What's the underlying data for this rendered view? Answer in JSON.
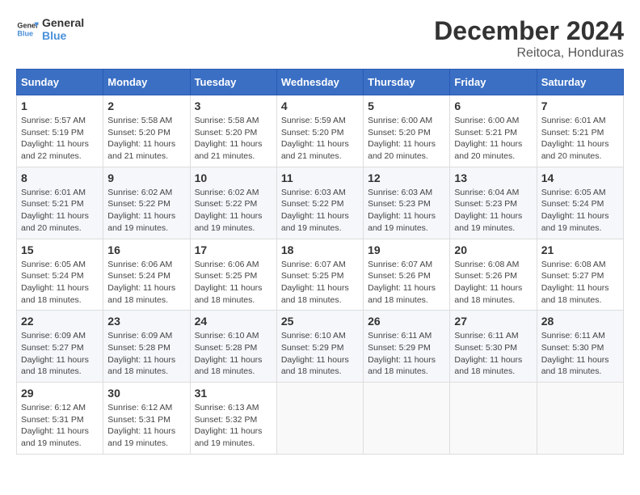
{
  "logo": {
    "line1": "General",
    "line2": "Blue"
  },
  "title": "December 2024",
  "location": "Reitoca, Honduras",
  "days_of_week": [
    "Sunday",
    "Monday",
    "Tuesday",
    "Wednesday",
    "Thursday",
    "Friday",
    "Saturday"
  ],
  "weeks": [
    [
      {
        "day": "1",
        "info": "Sunrise: 5:57 AM\nSunset: 5:19 PM\nDaylight: 11 hours\nand 22 minutes."
      },
      {
        "day": "2",
        "info": "Sunrise: 5:58 AM\nSunset: 5:20 PM\nDaylight: 11 hours\nand 21 minutes."
      },
      {
        "day": "3",
        "info": "Sunrise: 5:58 AM\nSunset: 5:20 PM\nDaylight: 11 hours\nand 21 minutes."
      },
      {
        "day": "4",
        "info": "Sunrise: 5:59 AM\nSunset: 5:20 PM\nDaylight: 11 hours\nand 21 minutes."
      },
      {
        "day": "5",
        "info": "Sunrise: 6:00 AM\nSunset: 5:20 PM\nDaylight: 11 hours\nand 20 minutes."
      },
      {
        "day": "6",
        "info": "Sunrise: 6:00 AM\nSunset: 5:21 PM\nDaylight: 11 hours\nand 20 minutes."
      },
      {
        "day": "7",
        "info": "Sunrise: 6:01 AM\nSunset: 5:21 PM\nDaylight: 11 hours\nand 20 minutes."
      }
    ],
    [
      {
        "day": "8",
        "info": "Sunrise: 6:01 AM\nSunset: 5:21 PM\nDaylight: 11 hours\nand 20 minutes."
      },
      {
        "day": "9",
        "info": "Sunrise: 6:02 AM\nSunset: 5:22 PM\nDaylight: 11 hours\nand 19 minutes."
      },
      {
        "day": "10",
        "info": "Sunrise: 6:02 AM\nSunset: 5:22 PM\nDaylight: 11 hours\nand 19 minutes."
      },
      {
        "day": "11",
        "info": "Sunrise: 6:03 AM\nSunset: 5:22 PM\nDaylight: 11 hours\nand 19 minutes."
      },
      {
        "day": "12",
        "info": "Sunrise: 6:03 AM\nSunset: 5:23 PM\nDaylight: 11 hours\nand 19 minutes."
      },
      {
        "day": "13",
        "info": "Sunrise: 6:04 AM\nSunset: 5:23 PM\nDaylight: 11 hours\nand 19 minutes."
      },
      {
        "day": "14",
        "info": "Sunrise: 6:05 AM\nSunset: 5:24 PM\nDaylight: 11 hours\nand 19 minutes."
      }
    ],
    [
      {
        "day": "15",
        "info": "Sunrise: 6:05 AM\nSunset: 5:24 PM\nDaylight: 11 hours\nand 18 minutes."
      },
      {
        "day": "16",
        "info": "Sunrise: 6:06 AM\nSunset: 5:24 PM\nDaylight: 11 hours\nand 18 minutes."
      },
      {
        "day": "17",
        "info": "Sunrise: 6:06 AM\nSunset: 5:25 PM\nDaylight: 11 hours\nand 18 minutes."
      },
      {
        "day": "18",
        "info": "Sunrise: 6:07 AM\nSunset: 5:25 PM\nDaylight: 11 hours\nand 18 minutes."
      },
      {
        "day": "19",
        "info": "Sunrise: 6:07 AM\nSunset: 5:26 PM\nDaylight: 11 hours\nand 18 minutes."
      },
      {
        "day": "20",
        "info": "Sunrise: 6:08 AM\nSunset: 5:26 PM\nDaylight: 11 hours\nand 18 minutes."
      },
      {
        "day": "21",
        "info": "Sunrise: 6:08 AM\nSunset: 5:27 PM\nDaylight: 11 hours\nand 18 minutes."
      }
    ],
    [
      {
        "day": "22",
        "info": "Sunrise: 6:09 AM\nSunset: 5:27 PM\nDaylight: 11 hours\nand 18 minutes."
      },
      {
        "day": "23",
        "info": "Sunrise: 6:09 AM\nSunset: 5:28 PM\nDaylight: 11 hours\nand 18 minutes."
      },
      {
        "day": "24",
        "info": "Sunrise: 6:10 AM\nSunset: 5:28 PM\nDaylight: 11 hours\nand 18 minutes."
      },
      {
        "day": "25",
        "info": "Sunrise: 6:10 AM\nSunset: 5:29 PM\nDaylight: 11 hours\nand 18 minutes."
      },
      {
        "day": "26",
        "info": "Sunrise: 6:11 AM\nSunset: 5:29 PM\nDaylight: 11 hours\nand 18 minutes."
      },
      {
        "day": "27",
        "info": "Sunrise: 6:11 AM\nSunset: 5:30 PM\nDaylight: 11 hours\nand 18 minutes."
      },
      {
        "day": "28",
        "info": "Sunrise: 6:11 AM\nSunset: 5:30 PM\nDaylight: 11 hours\nand 18 minutes."
      }
    ],
    [
      {
        "day": "29",
        "info": "Sunrise: 6:12 AM\nSunset: 5:31 PM\nDaylight: 11 hours\nand 19 minutes."
      },
      {
        "day": "30",
        "info": "Sunrise: 6:12 AM\nSunset: 5:31 PM\nDaylight: 11 hours\nand 19 minutes."
      },
      {
        "day": "31",
        "info": "Sunrise: 6:13 AM\nSunset: 5:32 PM\nDaylight: 11 hours\nand 19 minutes."
      },
      {
        "day": "",
        "info": ""
      },
      {
        "day": "",
        "info": ""
      },
      {
        "day": "",
        "info": ""
      },
      {
        "day": "",
        "info": ""
      }
    ]
  ]
}
